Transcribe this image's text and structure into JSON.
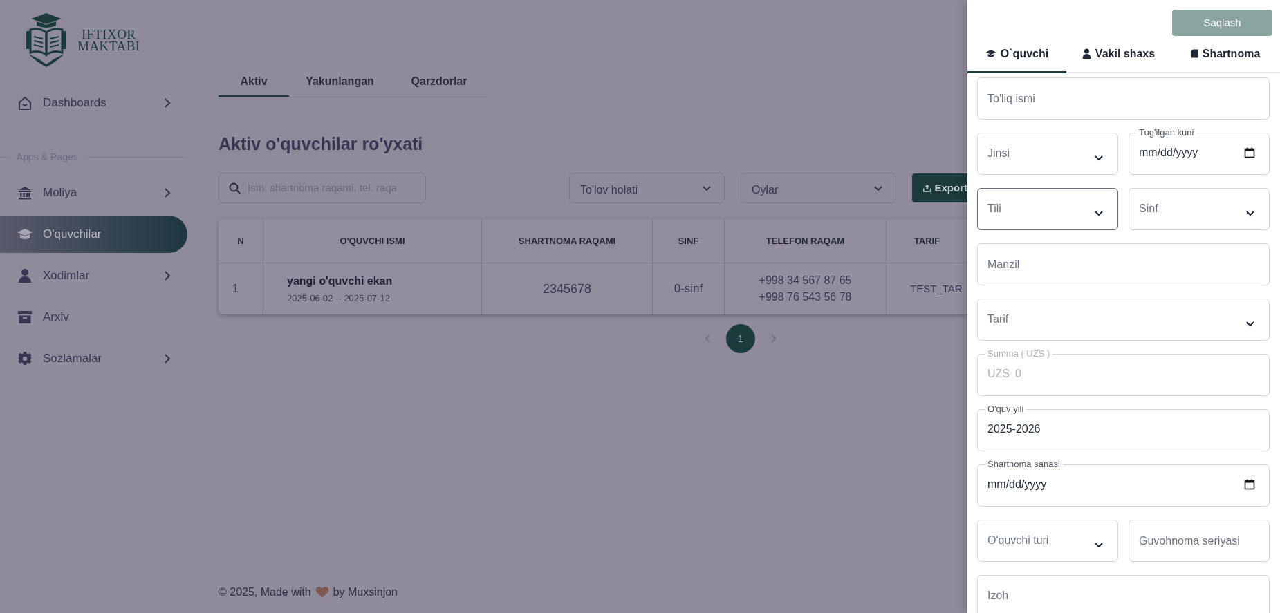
{
  "logo": {
    "line1": "IFTIXOR",
    "line2": "MAKTABI"
  },
  "sidebar": {
    "items": [
      {
        "kind": "link",
        "label": "Dashboards",
        "has_submenu": true,
        "selected": false
      },
      {
        "kind": "section",
        "label": "Apps & Pages"
      },
      {
        "kind": "link",
        "label": "Moliya",
        "has_submenu": true,
        "selected": false
      },
      {
        "kind": "link",
        "label": "O'quvchilar",
        "has_submenu": false,
        "selected": true
      },
      {
        "kind": "link",
        "label": "Xodimlar",
        "has_submenu": true,
        "selected": false
      },
      {
        "kind": "link",
        "label": "Arxiv",
        "has_submenu": false,
        "selected": false
      },
      {
        "kind": "link",
        "label": "Sozlamalar",
        "has_submenu": true,
        "selected": false
      }
    ]
  },
  "main": {
    "tabs": [
      {
        "label": "Aktiv",
        "selected": true
      },
      {
        "label": "Yakunlangan",
        "selected": false
      },
      {
        "label": "Qarzdorlar",
        "selected": false
      }
    ],
    "title": "Aktiv o'quvchilar ro'yxati",
    "search": {
      "placeholder": "Ism, shartnoma raqami, tel. raqa"
    },
    "filters": [
      {
        "placeholder": "To'lov holati"
      },
      {
        "placeholder": "Oylar"
      }
    ],
    "export_button": "Export",
    "table": {
      "columns": [
        "N",
        "O'QUVCHI ISMI",
        "SHARTNOMA RAQAMI",
        "SINF",
        "TELEFON RAQAM",
        "TARIF"
      ],
      "rows": [
        {
          "n": "1",
          "name": "yangi o'quvchi ekan",
          "dates": "2025-06-02 -- 2025-07-12",
          "contract": "2345678",
          "class": "0-sinf",
          "phones": [
            "+998 34 567 87 65",
            "+998 76 543 56 78"
          ],
          "tariff": "TEST_TAR"
        }
      ]
    },
    "pagination": [
      {
        "label": "1",
        "selected": true
      }
    ]
  },
  "footer": {
    "before": "© 2025, Made with",
    "after": "by Muxsinjon"
  },
  "drawer": {
    "save_button": "Saqlash",
    "tabs": [
      {
        "label": "O`quvchi",
        "selected": true
      },
      {
        "label": "Vakil shaxs",
        "selected": false
      },
      {
        "label": "Shartnoma",
        "selected": false
      }
    ],
    "rows": [
      [
        {
          "kind": "text",
          "placeholder": "To'liq ismi"
        }
      ],
      [
        {
          "kind": "select",
          "placeholder": "Jinsi",
          "focused": false
        },
        {
          "kind": "date",
          "label": "Tug'ilgan kuni",
          "value": "mm/dd/yyyy"
        }
      ],
      [
        {
          "kind": "select",
          "placeholder": "Tili",
          "focused": true
        },
        {
          "kind": "select",
          "placeholder": "Sinf",
          "focused": false
        }
      ],
      [
        {
          "kind": "text",
          "placeholder": "Manzil"
        }
      ],
      [
        {
          "kind": "select",
          "placeholder": "Tarif",
          "focused": false
        }
      ],
      [
        {
          "kind": "money",
          "label": "Summa ( UZS )",
          "prefix": "UZS",
          "value": "0",
          "disabled": true
        }
      ],
      [
        {
          "kind": "text",
          "label": "O'quv yili",
          "value": "2025-2026"
        }
      ],
      [
        {
          "kind": "date",
          "label": "Shartnoma sanasi",
          "value": "mm/dd/yyyy"
        }
      ],
      [
        {
          "kind": "select",
          "placeholder": "O'quvchi turi",
          "focused": false
        },
        {
          "kind": "text",
          "placeholder": "Guvohnoma seriyasi"
        }
      ],
      [
        {
          "kind": "textarea",
          "placeholder": "Izoh"
        }
      ]
    ]
  }
}
